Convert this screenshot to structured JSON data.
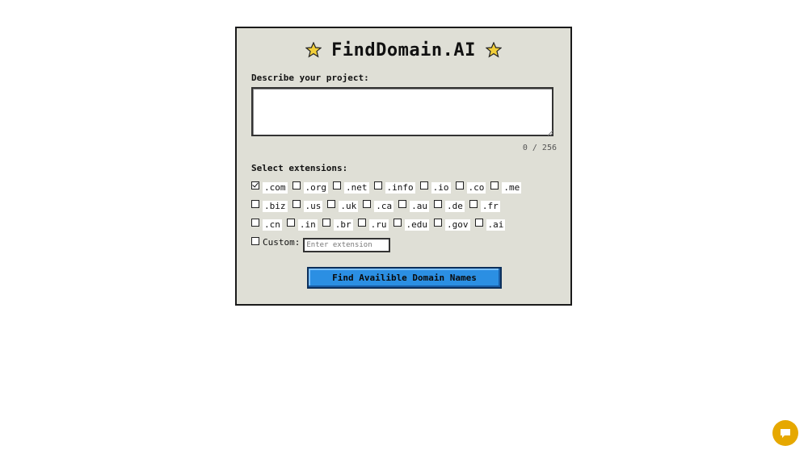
{
  "app": {
    "title": "FindDomain.AI"
  },
  "description": {
    "label": "Describe your project:",
    "value": "",
    "counter": "0 / 256"
  },
  "extensions": {
    "label": "Select extensions:",
    "rows": [
      [
        {
          "label": ".com",
          "checked": true
        },
        {
          "label": ".org",
          "checked": false
        },
        {
          "label": ".net",
          "checked": false
        },
        {
          "label": ".info",
          "checked": false
        },
        {
          "label": ".io",
          "checked": false
        },
        {
          "label": ".co",
          "checked": false
        },
        {
          "label": ".me",
          "checked": false
        }
      ],
      [
        {
          "label": ".biz",
          "checked": false
        },
        {
          "label": ".us",
          "checked": false
        },
        {
          "label": ".uk",
          "checked": false
        },
        {
          "label": ".ca",
          "checked": false
        },
        {
          "label": ".au",
          "checked": false
        },
        {
          "label": ".de",
          "checked": false
        },
        {
          "label": ".fr",
          "checked": false
        }
      ],
      [
        {
          "label": ".cn",
          "checked": false
        },
        {
          "label": ".in",
          "checked": false
        },
        {
          "label": ".br",
          "checked": false
        },
        {
          "label": ".ru",
          "checked": false
        },
        {
          "label": ".edu",
          "checked": false
        },
        {
          "label": ".gov",
          "checked": false
        },
        {
          "label": ".ai",
          "checked": false
        }
      ]
    ],
    "custom": {
      "label": "Custom:",
      "checked": false,
      "placeholder": "Enter extension",
      "value": ""
    }
  },
  "actions": {
    "find_label": "Find Availible Domain Names"
  },
  "icons": {
    "title_left": "star-icon",
    "title_right": "star-icon",
    "chat": "chat-bubble-icon"
  },
  "colors": {
    "card_background": "#dfdfd6",
    "button": "#2b8fe3",
    "star": "#f2cf3a",
    "chat_bubble": "#e6a800"
  }
}
